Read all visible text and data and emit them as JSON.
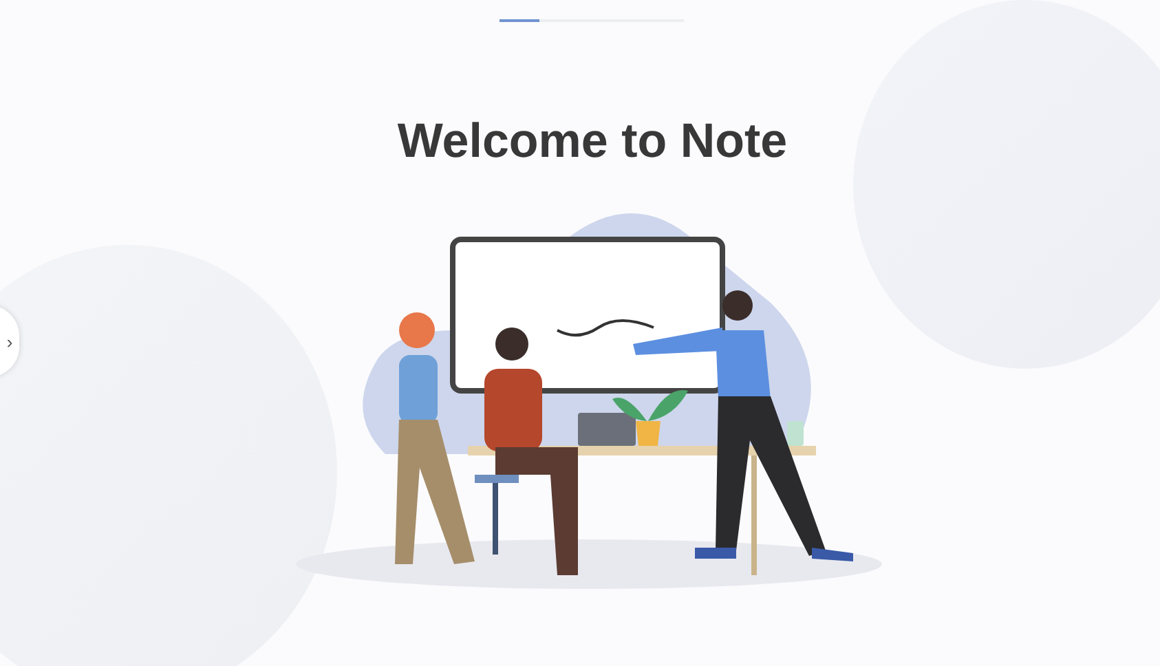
{
  "progress": {
    "level": 0.22
  },
  "title": "Welcome to Note",
  "side_tab": {
    "icon": "›"
  }
}
